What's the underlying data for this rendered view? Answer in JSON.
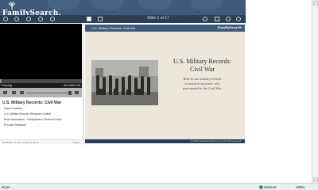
{
  "header": {
    "logo_text": "FamilySearch."
  },
  "toolbar": {
    "slide_counter": "Slide 1 of 17"
  },
  "player": {
    "progress": 0.02,
    "time_left": "Playing",
    "time_right": "00:00/03:48"
  },
  "chapters": {
    "title": "U.S. Military Records: Civil War",
    "items": [
      "Class Handout",
      "U.S. Military Records Research Outline",
      "More Information - FamilySearch Research Wiki",
      "Provide Feedback"
    ]
  },
  "left_footer": {
    "left": "00:00:00 / 17 Pps  Length 00:11:42",
    "right": "Slides"
  },
  "slide": {
    "tab_title": "U.S. Military Records: Civil War",
    "logo_text": "FamilySearch",
    "title_line_1": "U.S. Military Records:",
    "title_line_2": "Civil War",
    "desc_lines": [
      "How to use military records",
      "to research ancestors who",
      "participated in the Civil War."
    ],
    "copyright": "© 2010 Intellectual Reserve, Inc. All rights reserved."
  },
  "statusbar": {
    "left": "Done",
    "zone": "Internet",
    "zoom": "100%"
  },
  "colors": {
    "header_bg": "#3f5a7a",
    "slide_bg": "#ebe7da",
    "video_bg": "#000000"
  }
}
